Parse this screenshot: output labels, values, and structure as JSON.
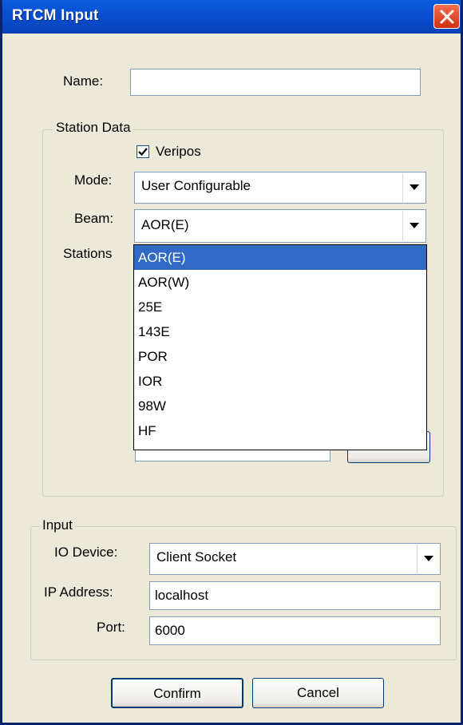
{
  "window": {
    "title": "RTCM Input"
  },
  "name_field": {
    "label": "Name:",
    "value": ""
  },
  "station_data": {
    "legend": "Station Data",
    "veripos": {
      "label": "Veripos",
      "checked": true
    },
    "mode": {
      "label": "Mode:",
      "value": "User Configurable"
    },
    "beam": {
      "label": "Beam:",
      "value": "AOR(E)",
      "options": [
        "AOR(E)",
        "AOR(W)",
        "25E",
        "143E",
        "POR",
        "IOR",
        "98W",
        "HF"
      ],
      "selected_index": 0
    },
    "stations": {
      "label": "Stations"
    }
  },
  "input": {
    "legend": "Input",
    "io_device": {
      "label": "IO Device:",
      "value": "Client Socket"
    },
    "ip_address": {
      "label": "IP Address:",
      "value": "localhost"
    },
    "port": {
      "label": "Port:",
      "value": "6000"
    }
  },
  "buttons": {
    "confirm": "Confirm",
    "cancel": "Cancel"
  },
  "colors": {
    "titlebar": "#0A4FD0",
    "selection": "#316AC5",
    "dialog_bg": "#ECE9D8"
  }
}
